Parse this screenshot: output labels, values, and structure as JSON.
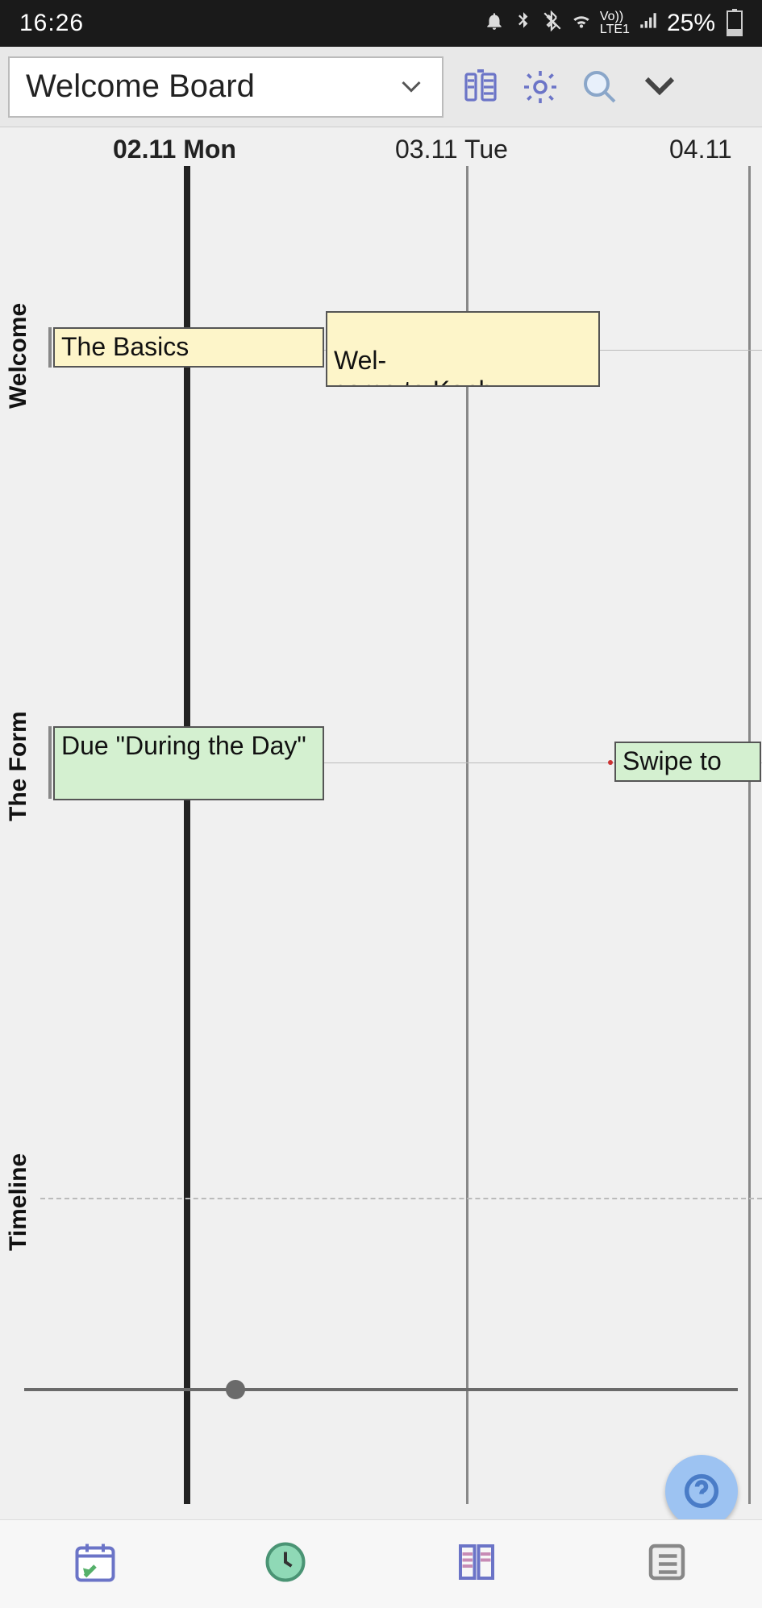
{
  "status": {
    "time": "16:26",
    "battery_pct": "25%",
    "network_label": "LTE1"
  },
  "toolbar": {
    "board_name": "Welcome Board"
  },
  "dates": {
    "col1": "02.11 Mon",
    "col2": "03.11 Tue",
    "col3": "04.11"
  },
  "rows": {
    "welcome": "Welcome",
    "theform": "The Form",
    "timeline": "Timeline"
  },
  "cards": {
    "basics": "The Basics",
    "welcome_kanb": "Wel-\ncome to Kanb…-",
    "due_during": "Due \"During the Day\"",
    "swipe_to": "Swipe to"
  },
  "icons": {
    "columns": "columns-icon",
    "gear": "gear-icon",
    "search": "search-icon",
    "collapse": "chevron-down-icon",
    "help": "help-icon"
  }
}
